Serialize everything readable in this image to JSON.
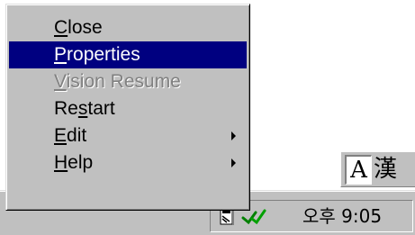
{
  "menu": {
    "items": [
      {
        "pre": "",
        "key": "C",
        "post": "lose",
        "state": "normal"
      },
      {
        "pre": "",
        "key": "P",
        "post": "roperties",
        "state": "selected"
      },
      {
        "pre": "",
        "key": "V",
        "post": "ision Resume",
        "state": "disabled"
      },
      {
        "pre": "Re",
        "key": "s",
        "post": "tart",
        "state": "normal",
        "submenu": false
      },
      {
        "pre": "",
        "key": "E",
        "post": "dit",
        "state": "normal",
        "submenu": true
      },
      {
        "pre": "",
        "key": "H",
        "post": "elp",
        "state": "normal",
        "submenu": true
      }
    ],
    "highlight_color": "#000080",
    "disabled_color": "#808080"
  },
  "ime": {
    "mode_glyph": "A",
    "hanja_glyph": "漢"
  },
  "tray": {
    "icons": [
      "document-icon",
      "green-checkmark-icon"
    ],
    "check_color": "#008000",
    "clock": "오후 9:05"
  }
}
